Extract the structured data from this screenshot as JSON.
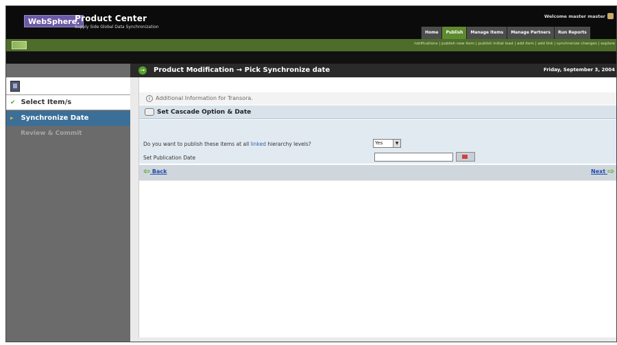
{
  "header": {
    "logo": "WebSphere.",
    "product_title": "Product Center",
    "product_subtitle": "Supply Side Global Data Synchronization",
    "welcome": "Welcome  master master",
    "tabs": [
      {
        "label": "Home",
        "active": false
      },
      {
        "label": "Publish",
        "active": true
      },
      {
        "label": "Manage Items",
        "active": false
      },
      {
        "label": "Manage Partners",
        "active": false
      },
      {
        "label": "Run Reports",
        "active": false
      }
    ]
  },
  "subbar": {
    "links": "notifications  | publish new item  | publish initial load  | add item  | add link  | synchronize changes | explore"
  },
  "sidebar": {
    "steps": [
      {
        "label": "Select Item/s",
        "marker": "✔",
        "state": "done"
      },
      {
        "label": "Synchronize Date",
        "marker": "▸",
        "state": "current"
      },
      {
        "label": "Review & Commit",
        "marker": "",
        "state": "disabled"
      }
    ]
  },
  "main": {
    "title": "Product Modification → Pick Synchronize date",
    "date": "Friday, September 3, 2004",
    "info": "Additional Information for Transora.",
    "section_title": "Set Cascade Option & Date",
    "question_prefix": "Do you want to publish these items at all ",
    "question_link": "linked",
    "question_suffix": " hierarchy levels?",
    "select_value": "Yes",
    "date_label": "Set Publication Date",
    "date_value": "",
    "back_label": "Back",
    "next_label": "Next"
  },
  "colors": {
    "accent_green": "#5aa02c",
    "active_step_blue": "#3c6f97",
    "link_blue": "#1d4aa8"
  }
}
